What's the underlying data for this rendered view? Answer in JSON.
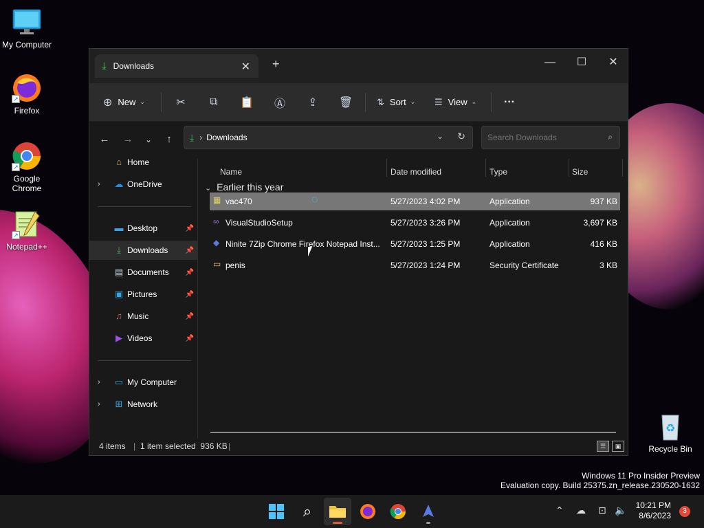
{
  "desktop": {
    "icons": [
      {
        "label": "My Computer",
        "icon": "monitor-icon"
      },
      {
        "label": "Firefox",
        "icon": "firefox-icon"
      },
      {
        "label": "Google Chrome",
        "icon": "chrome-icon"
      },
      {
        "label": "Notepad++",
        "icon": "notepadpp-icon"
      },
      {
        "label": "Recycle Bin",
        "icon": "recycle-bin-icon"
      }
    ]
  },
  "window": {
    "tab_title": "Downloads",
    "toolbar": {
      "new_label": "New",
      "sort_label": "Sort",
      "view_label": "View",
      "more_label": "···"
    },
    "address": {
      "path": "Downloads",
      "search_placeholder": "Search Downloads"
    },
    "sidebar": {
      "items": [
        {
          "label": "Home",
          "icon": "home-icon"
        },
        {
          "label": "OneDrive",
          "icon": "cloud-icon"
        },
        {
          "label": "Desktop",
          "icon": "desktop-icon"
        },
        {
          "label": "Downloads",
          "icon": "download-icon"
        },
        {
          "label": "Documents",
          "icon": "document-icon"
        },
        {
          "label": "Pictures",
          "icon": "pictures-icon"
        },
        {
          "label": "Music",
          "icon": "music-icon"
        },
        {
          "label": "Videos",
          "icon": "videos-icon"
        },
        {
          "label": "My Computer",
          "icon": "monitor-icon"
        },
        {
          "label": "Network",
          "icon": "network-icon"
        }
      ]
    },
    "columns": {
      "name": "Name",
      "date": "Date modified",
      "type": "Type",
      "size": "Size"
    },
    "group_header": "Earlier this year",
    "files": [
      {
        "name": "vac470",
        "date": "5/27/2023 4:02 PM",
        "type": "Application",
        "size": "937 KB"
      },
      {
        "name": "VisualStudioSetup",
        "date": "5/27/2023 3:26 PM",
        "type": "Application",
        "size": "3,697 KB"
      },
      {
        "name": "Ninite 7Zip Chrome Firefox Notepad Inst...",
        "date": "5/27/2023 1:25 PM",
        "type": "Application",
        "size": "416 KB"
      },
      {
        "name": "penis",
        "date": "5/27/2023 1:24 PM",
        "type": "Security Certificate",
        "size": "3 KB"
      }
    ],
    "status": {
      "items": "4 items",
      "selected": "1 item selected  936 KB"
    }
  },
  "watermark": {
    "line1": "Windows 11 Pro Insider Preview",
    "line2": "Evaluation copy. Build 25375.zn_release.230520-1632"
  },
  "taskbar": {
    "time": "10:21 PM",
    "date": "8/6/2023",
    "notification_count": "3"
  },
  "colors": {
    "accent": "#4cc2ff",
    "download_green": "#3fb950",
    "selected_row": "#777777"
  }
}
